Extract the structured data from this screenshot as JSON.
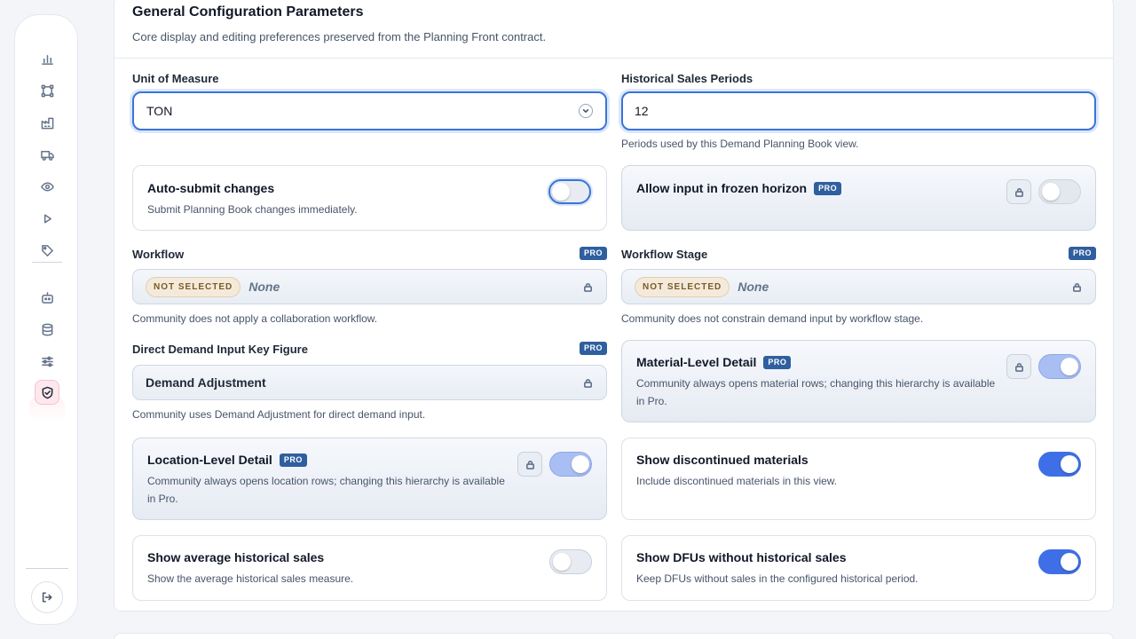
{
  "colors": {
    "accent": "#3f6fe6",
    "pro_badge": "#2f5f9e",
    "not_selected_badge": "#f4eadb",
    "active_nav": "#fde8ee"
  },
  "sidebar": {
    "items": [
      {
        "icon": "bar-chart-icon"
      },
      {
        "icon": "network-nodes-icon"
      },
      {
        "icon": "factory-icon"
      },
      {
        "icon": "truck-icon"
      },
      {
        "icon": "eye-icon"
      },
      {
        "icon": "play-icon"
      },
      {
        "icon": "tag-icon"
      },
      {
        "icon": "robot-icon"
      },
      {
        "icon": "database-icon"
      },
      {
        "icon": "sliders-icon"
      },
      {
        "icon": "shield-check-icon",
        "active": true
      }
    ],
    "logout_icon": "logout-icon"
  },
  "section": {
    "title": "General Configuration Parameters",
    "subtitle": "Core display and editing preferences preserved from the Planning Front contract."
  },
  "uom": {
    "label": "Unit of Measure",
    "value": "TON",
    "icon": "chevron-down-icon"
  },
  "historical_periods": {
    "label": "Historical Sales Periods",
    "value": "12",
    "helper": "Periods used by this Demand Planning Book view."
  },
  "auto_submit": {
    "title": "Auto-submit changes",
    "description": "Submit Planning Book changes immediately.",
    "enabled": false
  },
  "frozen_horizon": {
    "title": "Allow input in frozen horizon",
    "badge": "PRO",
    "enabled": false
  },
  "workflow": {
    "label": "Workflow",
    "badge": "PRO",
    "status": "NOT SELECTED",
    "value": "None",
    "helper": "Community does not apply a collaboration workflow."
  },
  "workflow_stage": {
    "label": "Workflow Stage",
    "badge": "PRO",
    "status": "NOT SELECTED",
    "value": "None",
    "helper": "Community does not constrain demand input by workflow stage."
  },
  "direct_demand": {
    "label": "Direct Demand Input Key Figure",
    "badge": "PRO",
    "value": "Demand Adjustment",
    "helper": "Community uses Demand Adjustment for direct demand input."
  },
  "material_level": {
    "title": "Material-Level Detail",
    "badge": "PRO",
    "description": "Community always opens material rows; changing this hierarchy is available in Pro.",
    "enabled": true
  },
  "location_level": {
    "title": "Location-Level Detail",
    "badge": "PRO",
    "description": "Community always opens location rows; changing this hierarchy is available in Pro.",
    "enabled": true
  },
  "discontinued": {
    "title": "Show discontinued materials",
    "description": "Include discontinued materials in this view.",
    "enabled": true
  },
  "avg_sales": {
    "title": "Show average historical sales",
    "description": "Show the average historical sales measure.",
    "enabled": false
  },
  "dfus_without_sales": {
    "title": "Show DFUs without historical sales",
    "description": "Keep DFUs without sales in the configured historical period.",
    "enabled": true
  }
}
